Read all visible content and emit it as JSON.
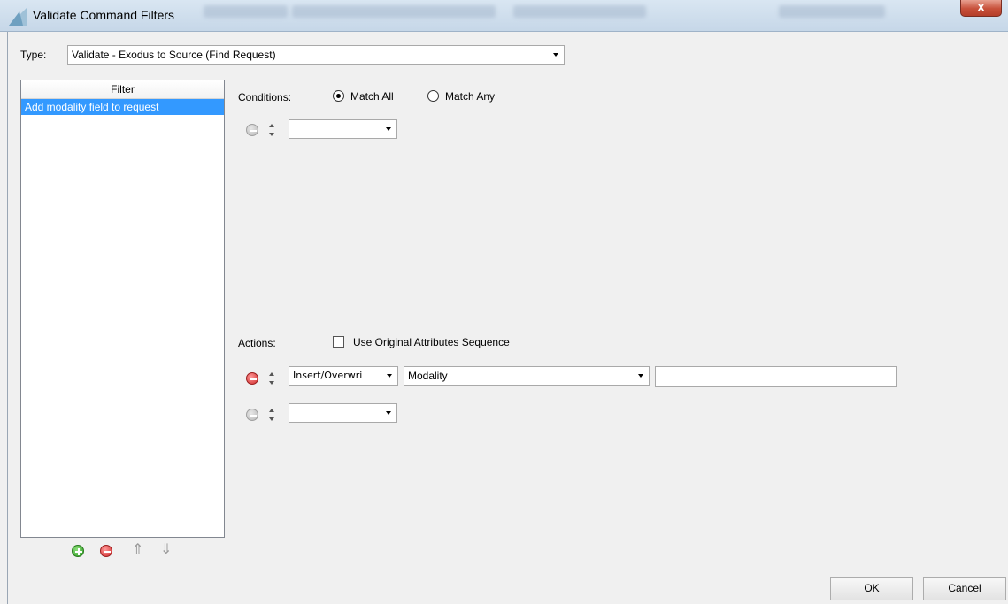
{
  "window": {
    "title": "Validate Command Filters",
    "close_glyph": "X"
  },
  "type": {
    "label": "Type:",
    "value": "Validate - Exodus to Source (Find Request)"
  },
  "filter_list": {
    "header": "Filter",
    "items": [
      "Add modality field to request"
    ]
  },
  "conditions": {
    "label": "Conditions:",
    "match_all": "Match All",
    "match_any": "Match Any",
    "selected": "match_all",
    "rows": [
      {
        "operator": ""
      }
    ]
  },
  "actions": {
    "label": "Actions:",
    "use_original_sequence": {
      "label": "Use Original Attributes Sequence",
      "checked": false
    },
    "rows": [
      {
        "operation": "Insert/Overwri",
        "attribute": "Modality",
        "value": ""
      },
      {
        "operation": "",
        "attribute": null,
        "value": null
      }
    ]
  },
  "buttons": {
    "ok": "OK",
    "cancel": "Cancel"
  },
  "icons": {
    "add": "add-circle-icon",
    "remove": "remove-circle-icon",
    "move_up": "arrow-up-icon",
    "move_down": "arrow-down-icon"
  },
  "colors": {
    "selection": "#3399ff",
    "add": "#2e9a23",
    "remove": "#d02a2a",
    "disabled": "#b8b8b8"
  }
}
